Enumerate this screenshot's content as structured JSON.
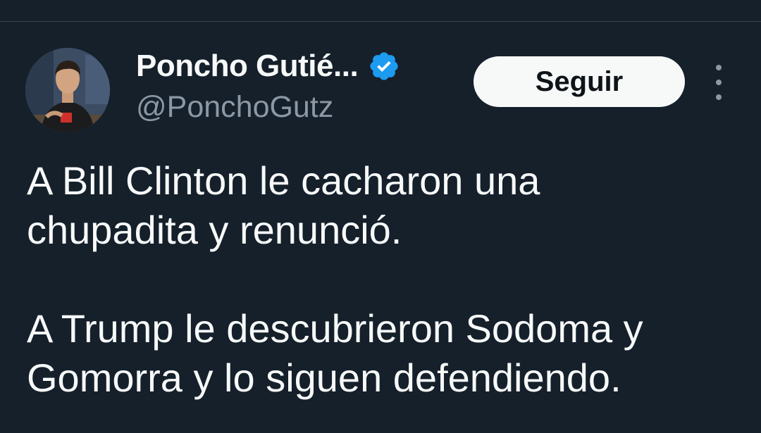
{
  "author": {
    "display_name": "Poncho Gutié...",
    "handle": "@PonchoGutz",
    "verified_icon": "verified-badge-icon",
    "avatar_icon": "avatar-photo"
  },
  "actions": {
    "follow_label": "Seguir",
    "more_icon": "more-options-icon"
  },
  "tweet": {
    "paragraphs": [
      [
        "A Bill Clinton le cacharon una",
        "chupadita y renunció."
      ],
      [
        "A Trump le descubrieron Sodoma y",
        "Gomorra y lo siguen defendiendo."
      ]
    ]
  },
  "colors": {
    "background": "#15202b",
    "text": "#f7f9f9",
    "secondary_text": "#8b98a5",
    "verified_blue": "#1d9bf0",
    "button_bg": "#f7f9f9",
    "button_text": "#0f1419"
  }
}
